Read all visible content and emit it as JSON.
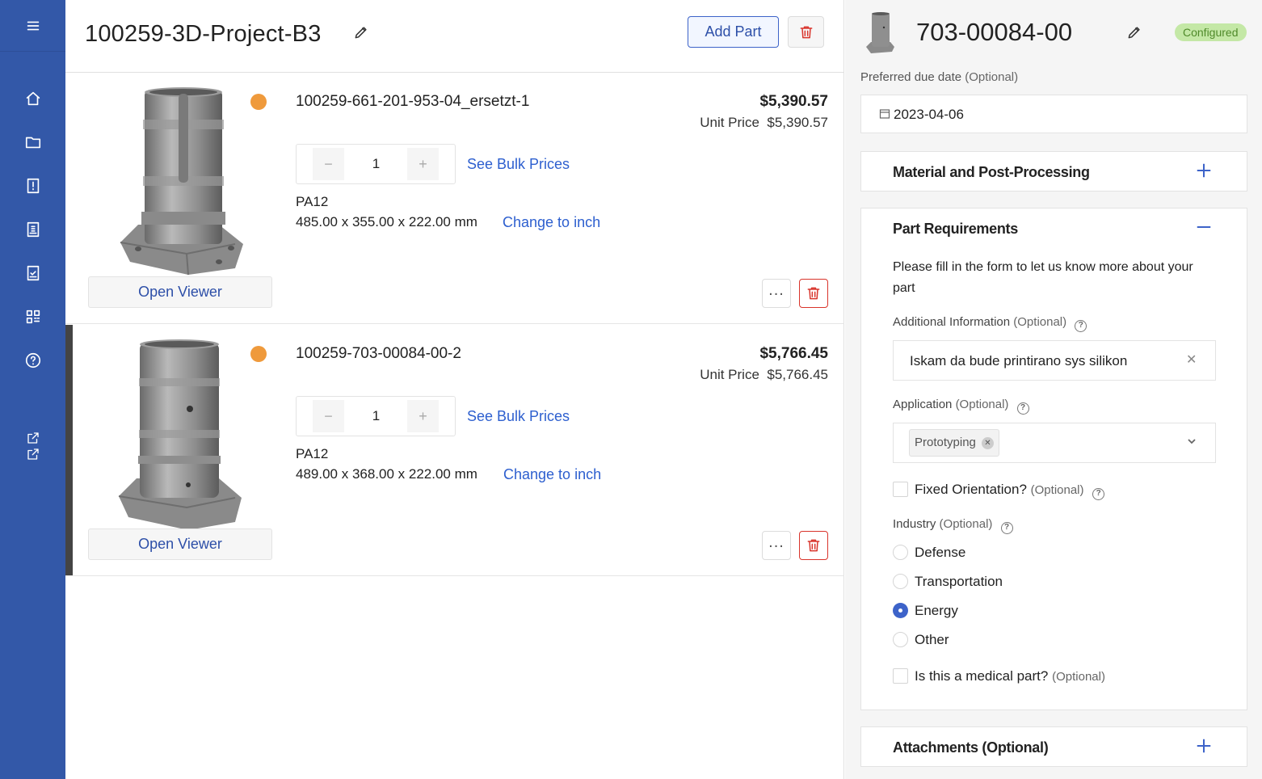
{
  "project": {
    "title": "100259-3D-Project-B3",
    "add_part_label": "Add Part"
  },
  "parts": [
    {
      "name": "100259-661-201-953-04_ersetzt-1",
      "price": "$5,390.57",
      "unit_price_label": "Unit Price",
      "unit_price": "$5,390.57",
      "quantity": "1",
      "bulk_label": "See Bulk Prices",
      "material": "PA12",
      "dimensions": "485.00 x 355.00 x 222.00 mm",
      "unit_toggle": "Change to inch",
      "viewer_label": "Open Viewer",
      "status_color": "#ef9a3c"
    },
    {
      "name": "100259-703-00084-00-2",
      "price": "$5,766.45",
      "unit_price_label": "Unit Price",
      "unit_price": "$5,766.45",
      "quantity": "1",
      "bulk_label": "See Bulk Prices",
      "material": "PA12",
      "dimensions": "489.00 x 368.00 x 222.00 mm",
      "unit_toggle": "Change to inch",
      "viewer_label": "Open Viewer",
      "status_color": "#ef9a3c"
    }
  ],
  "panel": {
    "title": "703-00084-00",
    "status_badge": "Configured",
    "due_date_label": "Preferred due date",
    "optional": "(Optional)",
    "due_date": "2023-04-06",
    "material_section": "Material and Post-Processing",
    "requirements_section": "Part Requirements",
    "requirements_intro": "Please fill in the form to let us know more about your part",
    "additional_info_label": "Additional Information",
    "additional_info_value": "Iskam da bude printirano sys silikon",
    "application_label": "Application",
    "application_tag": "Prototyping",
    "fixed_orientation_label": "Fixed Orientation?",
    "industry_label": "Industry",
    "industry_options": [
      "Defense",
      "Transportation",
      "Energy",
      "Other"
    ],
    "industry_selected": "Energy",
    "medical_label": "Is this a medical part?",
    "attachments_section": "Attachments (Optional)"
  },
  "sidebar": {
    "icons": [
      "menu-icon",
      "home-icon",
      "folder-icon",
      "quote-icon",
      "invoice-icon",
      "checklist-icon",
      "qr-icon",
      "help-icon",
      "external-link-icon"
    ]
  },
  "colors": {
    "sidebar": "#3358a8",
    "accent": "#3d63c9",
    "link": "#2d5fcf",
    "danger": "#d9342b",
    "badge_bg": "#c4e8a6"
  }
}
